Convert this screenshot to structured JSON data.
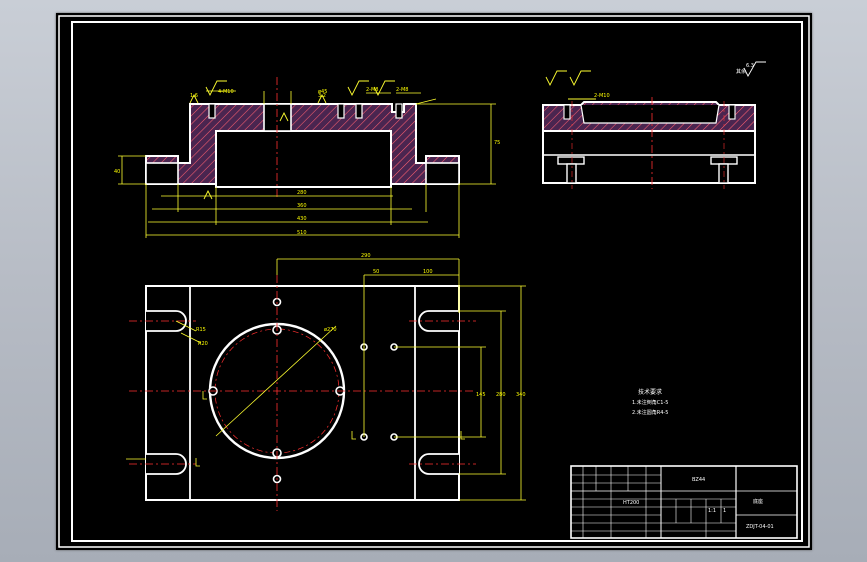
{
  "drawing": {
    "title_block": {
      "part_name": "底座",
      "code": "BZ44",
      "drawing_number": "ZDJT-04-01",
      "material_cell": "HT200",
      "scale_cell": "1:1",
      "sheet_cell": "1"
    },
    "tech_req": {
      "heading": "技术要求",
      "items": [
        "1.未注倒角C1-5",
        "2.未注圆角R4-5"
      ]
    },
    "roughness_note": {
      "label": "其余",
      "value": "6.3"
    },
    "front_view": {
      "dims": {
        "d_280": "280",
        "d_360": "360",
        "d_430": "430",
        "d_510": "510",
        "d_75": "75",
        "d_40": "40",
        "d_45": "ø45",
        "d_2m8_a": "2-M8",
        "d_2m8_b": "2-M8",
        "d_4m10": "4-M10",
        "r_a": "1.6",
        "r_b": "3.2"
      }
    },
    "top_view": {
      "dims": {
        "d_290": "290",
        "d_50": "50",
        "d_100": "100",
        "d_145": "145",
        "d_280": "280",
        "d_340": "340",
        "d_circle": "ø270",
        "d_r15": "R15",
        "d_r20": "R20"
      }
    }
  }
}
